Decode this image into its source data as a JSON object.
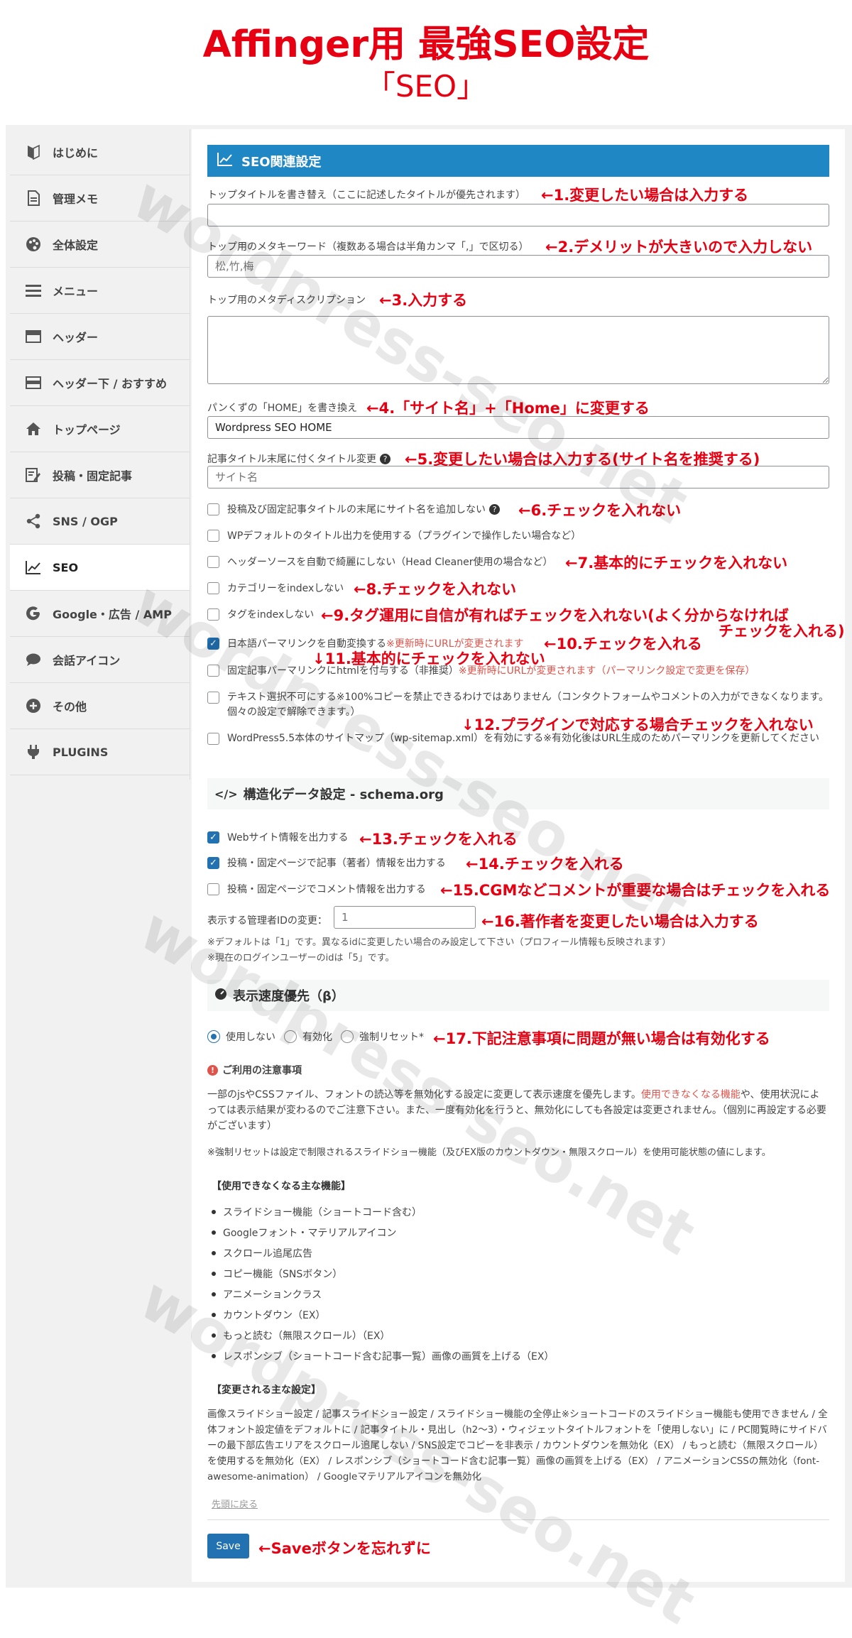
{
  "heading": {
    "title": "Affinger用 最強SEO設定",
    "subtitle": "「SEO」"
  },
  "sidebar": {
    "items": [
      {
        "label": "はじめに",
        "icon": "beginner-mark-icon"
      },
      {
        "label": "管理メモ",
        "icon": "document-icon"
      },
      {
        "label": "全体設定",
        "icon": "palette-icon"
      },
      {
        "label": "メニュー",
        "icon": "menu-icon"
      },
      {
        "label": "ヘッダー",
        "icon": "header-layout-icon"
      },
      {
        "label": "ヘッダー下 / おすすめ",
        "icon": "header-below-layout-icon"
      },
      {
        "label": "トップページ",
        "icon": "home-icon"
      },
      {
        "label": "投稿・固定記事",
        "icon": "edit-post-icon"
      },
      {
        "label": "SNS / OGP",
        "icon": "share-icon"
      },
      {
        "label": "SEO",
        "icon": "chart-line-icon"
      },
      {
        "label": "Google・広告 / AMP",
        "icon": "google-icon"
      },
      {
        "label": "会話アイコン",
        "icon": "speech-bubble-icon"
      },
      {
        "label": "その他",
        "icon": "plus-circle-icon"
      },
      {
        "label": "PLUGINS",
        "icon": "plug-icon"
      }
    ]
  },
  "seo": {
    "section_title": "SEO関連設定",
    "top_title_label": "トップタイトルを書き替え（ここに記述したタイトルが優先されます）",
    "meta_keywords_label": "トップ用のメタキーワード（複数ある場合は半角カンマ「,」で区切る）",
    "meta_keywords_placeholder": "松,竹,梅",
    "meta_desc_label": "トップ用のメタディスクリプション",
    "breadcrumb_label": "パンくずの「HOME」を書き換え",
    "breadcrumb_value": "Wordpress SEO HOME",
    "title_suffix_label": "記事タイトル末尾に付くタイトル変更",
    "title_suffix_placeholder": "サイト名",
    "cb1": "投稿及び固定記事タイトルの末尾にサイト名を追加しない",
    "cb2": "WPデフォルトのタイトル出力を使用する（プラグインで操作したい場合など）",
    "cb3": "ヘッダーソースを自動で綺麗にしない（Head Cleaner使用の場合など）",
    "cb4": "カテゴリーをindexしない",
    "cb5": "タグをindexしない",
    "cb6": "日本語パーマリンクを自動変換する",
    "cb6_note": "※更新時にURLが変更されます",
    "cb7": "固定記事パーマリンクにhtmlを付与する（非推奨）",
    "cb7_note": "※更新時にURLが変更されます（パーマリンク設定で変更を保存）",
    "cb8": "テキスト選択不可にする※100%コピーを禁止できるわけではありません（コンタクトフォームやコメントの入力ができなくなります。個々の設定で解除できます。）",
    "cb9": "WordPress5.5本体のサイトマップ（wp-sitemap.xml）を有効にする※有効化後はURL生成のためパーマリンクを更新してください"
  },
  "schema": {
    "section_title": "構造化データ設定 - schema.org",
    "cb1": "Webサイト情報を出力する",
    "cb2": "投稿・固定ページで記事（著者）情報を出力する",
    "cb3": "投稿・固定ページでコメント情報を出力する",
    "admin_id_label": "表示する管理者IDの変更：",
    "admin_id_placeholder": "1",
    "note1": "※デフォルトは「1」です。異なるidに変更したい場合のみ設定して下さい（プロフィール情報も反映されます）",
    "note2": "※現在のログインユーザーのidは「5」です。"
  },
  "speed": {
    "section_title": "表示速度優先（β）",
    "radio1": "使用しない",
    "radio2": "有効化",
    "radio3": "強制リセット*",
    "notice_title": "ご利用の注意事項",
    "para1_a": "一部のjsやCSSファイル、フォントの読込等を無効化する設定に変更して表示速度を優先します。",
    "para1_link": "使用できなくなる機能",
    "para1_b": "や、使用状況によっては表示結果が変わるのでご注意下さい。また、一度有効化を行うと、無効化にしても各設定は変更されません。（個別に再設定する必要がございます）",
    "para2": "※強制リセットは設定で制限されるスライドショー機能（及びEX版のカウントダウン・無限スクロール）を使用可能状態の値にします。",
    "unusable_heading": "【使用できなくなる主な機能】",
    "unusable_items": [
      "スライドショー機能（ショートコード含む）",
      "Googleフォント・マテリアルアイコン",
      "スクロール追尾広告",
      "コピー機能（SNSボタン）",
      "アニメーションクラス",
      "カウントダウン（EX）",
      "もっと読む（無限スクロール）（EX）",
      "レスポンシブ（ショートコード含む記事一覧）画像の画質を上げる（EX）"
    ],
    "changed_heading": "【変更される主な設定】",
    "changed_text": "画像スライドショー設定 / 記事スライドショー設定 / スライドショー機能の全停止※ショートコードのスライドショー機能も使用できません / 全体フォント設定値をデフォルトに / 記事タイトル・見出し（h2〜3）・ウィジェットタイトルフォントを「使用しない」に / PC閲覧時にサイドバーの最下部広告エリアをスクロール追尾しない / SNS設定でコピーを非表示 / カウントダウンを無効化（EX） / もっと読む（無限スクロール）を使用するを無効化（EX） / レスポンシブ（ショートコード含む記事一覧）画像の画質を上げる（EX） / アニメーションCSSの無効化（font-awesome-animation） / Googleマテリアルアイコンを無効化",
    "back_to_top": "先頭に戻る",
    "save": "Save"
  },
  "annotations": {
    "a1": "←1.変更したい場合は入力する",
    "a2": "←2.デメリットが大きいので入力しない",
    "a3": "←3.入力する",
    "a4": "←4.「サイト名」+「Home」に変更する",
    "a5": "←5.変更したい場合は入力する(サイト名を推奨する)",
    "a6": "←6.チェックを入れない",
    "a7": "←7.基本的にチェックを入れない",
    "a8": "←8.チェックを入れない",
    "a9": "←9.タグ運用に自信が有ればチェックを入れない(よく分からなければ",
    "a9b": "チェックを入れる)",
    "a10": "←10.チェックを入れる",
    "a11": "↓11.基本的にチェックを入れない",
    "a12": "↓12.プラグインで対応する場合チェックを入れない",
    "a13": "←13.チェックを入れる",
    "a14": "←14.チェックを入れる",
    "a15": "←15.CGMなどコメントが重要な場合はチェックを入れる",
    "a16": "←16.著作者を変更したい場合は入力する",
    "a17": "←17.下記注意事項に問題が無い場合は有効化する",
    "save": "←Saveボタンを忘れずに"
  },
  "watermark": "wordpress-seo.net",
  "colors": {
    "accent": "#1f87c4",
    "annotation": "#e60012",
    "button": "#2271b1"
  }
}
